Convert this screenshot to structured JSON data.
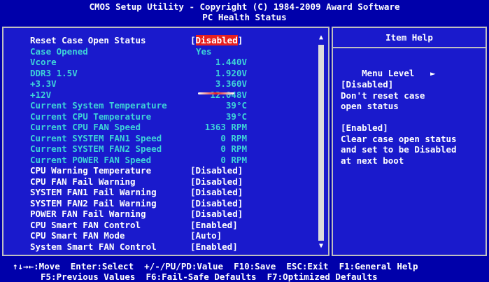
{
  "header": {
    "title": "CMOS Setup Utility - Copyright (C) 1984-2009 Award Software",
    "subtitle": "PC Health Status"
  },
  "settings": [
    {
      "label": "Reset Case Open Status",
      "value": "[Disabled]",
      "editable": true,
      "selected": true
    },
    {
      "label": "Case Opened",
      "value": "Yes",
      "editable": false
    },
    {
      "label": "Vcore",
      "value": "1.440V",
      "editable": false
    },
    {
      "label": "DDR3 1.5V",
      "value": "1.920V",
      "editable": false
    },
    {
      "label": "+3.3V",
      "value": "3.360V",
      "editable": false
    },
    {
      "label": "+12V",
      "value": "12.048V",
      "editable": false
    },
    {
      "label": "Current System Temperature",
      "value": "39°C",
      "editable": false
    },
    {
      "label": "Current CPU Temperature",
      "value": "39°C",
      "editable": false
    },
    {
      "label": "Current CPU FAN Speed",
      "value": "1363 RPM",
      "editable": false
    },
    {
      "label": "Current SYSTEM FAN1 Speed",
      "value": "0 RPM",
      "editable": false
    },
    {
      "label": "Current SYSTEM FAN2 Speed",
      "value": "0 RPM",
      "editable": false
    },
    {
      "label": "Current POWER FAN Speed",
      "value": "0 RPM",
      "editable": false
    },
    {
      "label": "CPU Warning Temperature",
      "value": "[Disabled]",
      "editable": true
    },
    {
      "label": "CPU FAN Fail Warning",
      "value": "[Disabled]",
      "editable": true
    },
    {
      "label": "SYSTEM FAN1 Fail Warning",
      "value": "[Disabled]",
      "editable": true
    },
    {
      "label": "SYSTEM FAN2 Fail Warning",
      "value": "[Disabled]",
      "editable": true
    },
    {
      "label": "POWER FAN Fail Warning",
      "value": "[Disabled]",
      "editable": true
    },
    {
      "label": "CPU Smart FAN Control",
      "value": "[Enabled]",
      "editable": true
    },
    {
      "label": "CPU Smart FAN Mode",
      "value": "[Auto]",
      "editable": true
    },
    {
      "label": "System Smart FAN Control",
      "value": "[Enabled]",
      "editable": true
    }
  ],
  "help": {
    "title": "Item Help",
    "menu_level": "Menu Level",
    "menu_level_arrow": "►",
    "lines": [
      "[Disabled]",
      "Don't reset case",
      "open status",
      "",
      "[Enabled]",
      "Clear case open status",
      "and set to be Disabled",
      "at next boot"
    ]
  },
  "scrollbar": {
    "up_icon": "▲",
    "down_icon": "▼"
  },
  "footer": {
    "line1": "↑↓→←:Move  Enter:Select  +/-/PU/PD:Value  F10:Save  ESC:Exit  F1:General Help",
    "line2": "F5:Previous Values  F6:Fail-Safe Defaults  F7:Optimized Defaults"
  },
  "colors": {
    "background": "#0000aa",
    "panel": "#1a1acc",
    "readonly_text": "#3ed3d8",
    "editable_text": "#ffffff",
    "highlight": "#e82020",
    "border": "#bfbfbf"
  }
}
